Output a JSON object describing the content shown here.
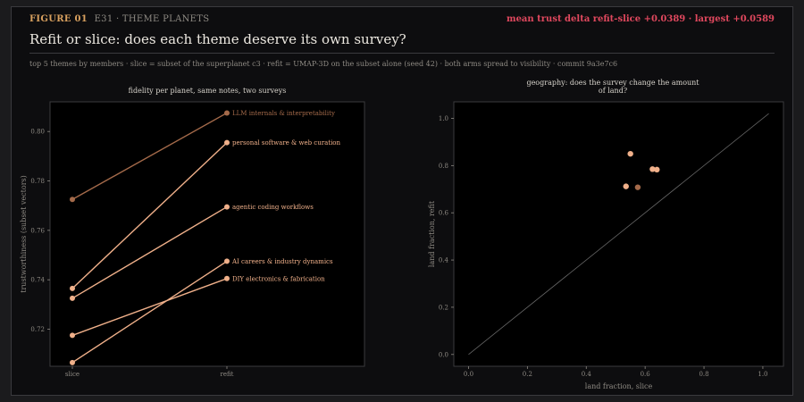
{
  "header": {
    "figure_label": "FIGURE 01",
    "figure_subtitle": "E31 · THEME PLANETS",
    "headline_stat": "mean trust delta refit-slice +0.0389 · largest +0.0589",
    "title": "Refit or slice: does each theme deserve its own survey?",
    "subtitle": "top 5 themes by members · slice = subset of the superplanet c3 · refit = UMAP-3D on the subset alone (seed 42) · both arms spread to visibility · commit 9a3e7c6"
  },
  "colors": {
    "background": "#0d0d0f",
    "accent": "#d9a15f",
    "headline": "#e0485e",
    "series_highlight": "#a46a4a",
    "series_default": "#f0b08a",
    "diagonal": "#666666"
  },
  "chart_data": [
    {
      "type": "line",
      "title": "fidelity per planet, same notes, two surveys",
      "xlabel": "",
      "ylabel": "trustworthiness (subset vectors)",
      "categories": [
        "slice",
        "refit"
      ],
      "ylim": [
        0.705,
        0.812
      ],
      "yticks": [
        0.72,
        0.74,
        0.76,
        0.78,
        0.8
      ],
      "grid": false,
      "series": [
        {
          "name": "LLM internals & interpretability",
          "values": [
            0.7725,
            0.8075
          ],
          "color": "#a46a4a"
        },
        {
          "name": "personal software & web curation",
          "values": [
            0.7365,
            0.7955
          ],
          "color": "#f0b08a"
        },
        {
          "name": "agentic coding workflows",
          "values": [
            0.7325,
            0.7695
          ],
          "color": "#f0b08a"
        },
        {
          "name": "AI careers & industry dynamics",
          "values": [
            0.7065,
            0.7475
          ],
          "color": "#f0b08a"
        },
        {
          "name": "DIY electronics & fabrication",
          "values": [
            0.7175,
            0.7405
          ],
          "color": "#f0b08a"
        }
      ]
    },
    {
      "type": "scatter",
      "title": "geography: does the survey change the amount of land?",
      "xlabel": "land fraction, slice",
      "ylabel": "land fraction, refit",
      "xlim": [
        -0.05,
        1.07
      ],
      "ylim": [
        -0.05,
        1.07
      ],
      "xticks": [
        0.0,
        0.2,
        0.4,
        0.6,
        0.8,
        1.0
      ],
      "yticks": [
        0.0,
        0.2,
        0.4,
        0.6,
        0.8,
        1.0
      ],
      "diagonal": true,
      "grid": false,
      "points": [
        {
          "x": 0.55,
          "y": 0.85,
          "color": "#f0b08a"
        },
        {
          "x": 0.625,
          "y": 0.785,
          "color": "#f0b08a"
        },
        {
          "x": 0.64,
          "y": 0.783,
          "color": "#f0b08a"
        },
        {
          "x": 0.535,
          "y": 0.712,
          "color": "#f0b08a"
        },
        {
          "x": 0.575,
          "y": 0.708,
          "color": "#a46a4a"
        }
      ]
    }
  ]
}
